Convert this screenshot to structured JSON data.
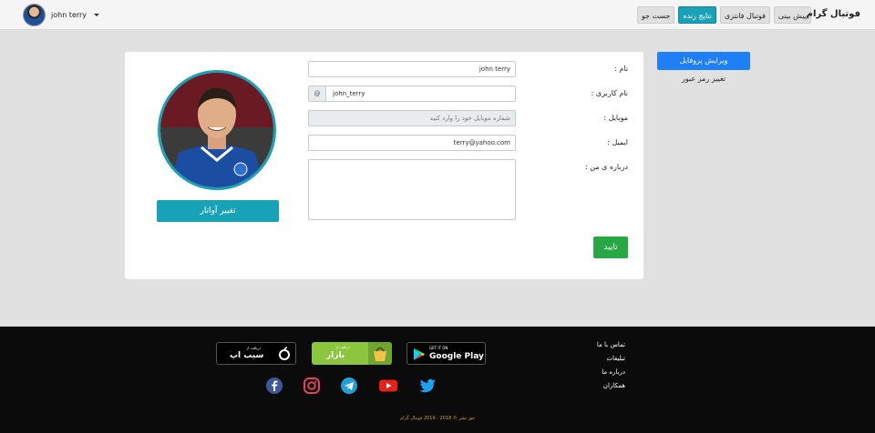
{
  "header": {
    "brand": "فوتبال گرام",
    "user": {
      "name": "john terry"
    },
    "nav": [
      {
        "label": "پیش بینی",
        "active": false
      },
      {
        "label": "فوتبال فانتزی",
        "active": false
      },
      {
        "label": "نتایج زنده",
        "active": true
      },
      {
        "label": "جست جو",
        "active": false
      }
    ]
  },
  "sidebar": {
    "edit_profile": "ویرایش پروفایل",
    "change_password": "تغییر رمز عبور"
  },
  "profile": {
    "change_avatar": "تغییر آواتار",
    "fields": {
      "name_label": "نام :",
      "name_value": "john terry",
      "username_label": "نام کاربری :",
      "username_prefix": "@",
      "username_value": "john_terry",
      "mobile_label": "موبایل :",
      "mobile_placeholder": "شماره موبایل خود را وارد کنید",
      "email_label": "ایمیل :",
      "email_value": "terry@yahoo.com",
      "about_label": "درباره ی من :"
    },
    "submit": "تایید"
  },
  "footer": {
    "links": [
      "تماس با ما",
      "تبلیغات",
      "درباره ما",
      "همکاران"
    ],
    "stores": {
      "sibapp_small": "دریافت از",
      "sibapp_big": "سیب اپ",
      "bazaar_small": "دریافت از",
      "bazaar_big": "بازار",
      "play_small": "GET IT ON",
      "play_big": "Google Play"
    },
    "social_icons": [
      "facebook-icon",
      "instagram-icon",
      "telegram-icon",
      "youtube-icon",
      "twitter-icon"
    ],
    "copyright": "حق نشر © 2018 - 2019 فوتبال گرام"
  },
  "colors": {
    "accent": "#17a2b8",
    "primary": "#1e7ff7",
    "success": "#28a745",
    "footer_bg": "#0b0b0b",
    "copyright": "#c9a227"
  }
}
